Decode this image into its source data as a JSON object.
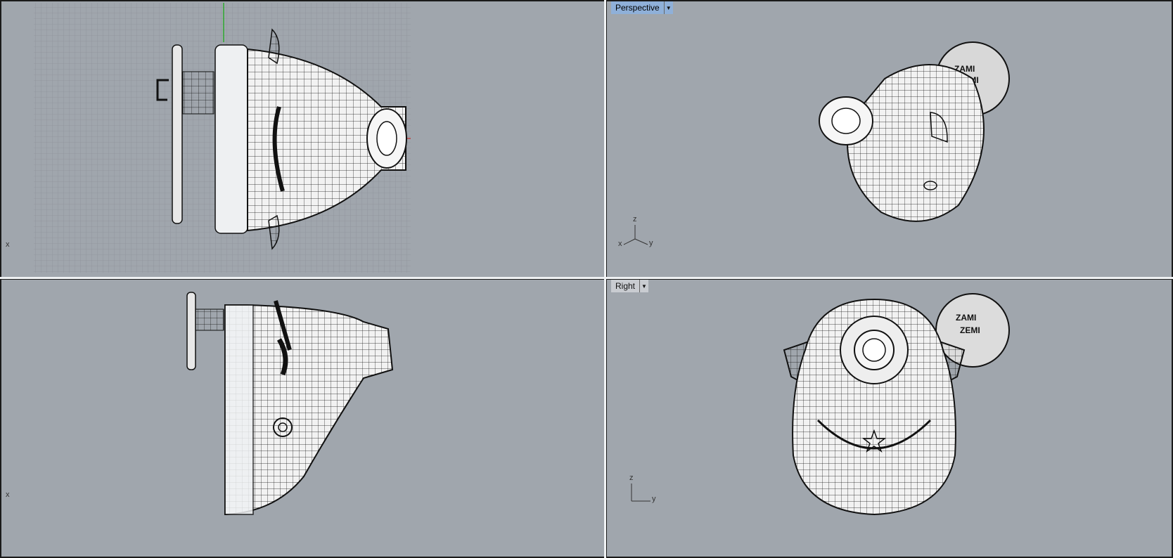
{
  "viewports": {
    "top_left": {
      "axis_label": "x"
    },
    "top_right": {
      "name": "Perspective",
      "axis_z": "z",
      "axis_y": "y",
      "axis_x": "x"
    },
    "bottom_left": {
      "axis_label": "x"
    },
    "bottom_right": {
      "name": "Right",
      "axis_z": "z",
      "axis_y": "y"
    }
  },
  "model": {
    "emblem_line1": "ZAMI",
    "emblem_line2": "ZEMI"
  },
  "colors": {
    "viewport_bg": "#a0a6ad",
    "grid_line": "#8e949b",
    "active_label": "#8fb0d9",
    "separator": "#f0f2f4"
  }
}
